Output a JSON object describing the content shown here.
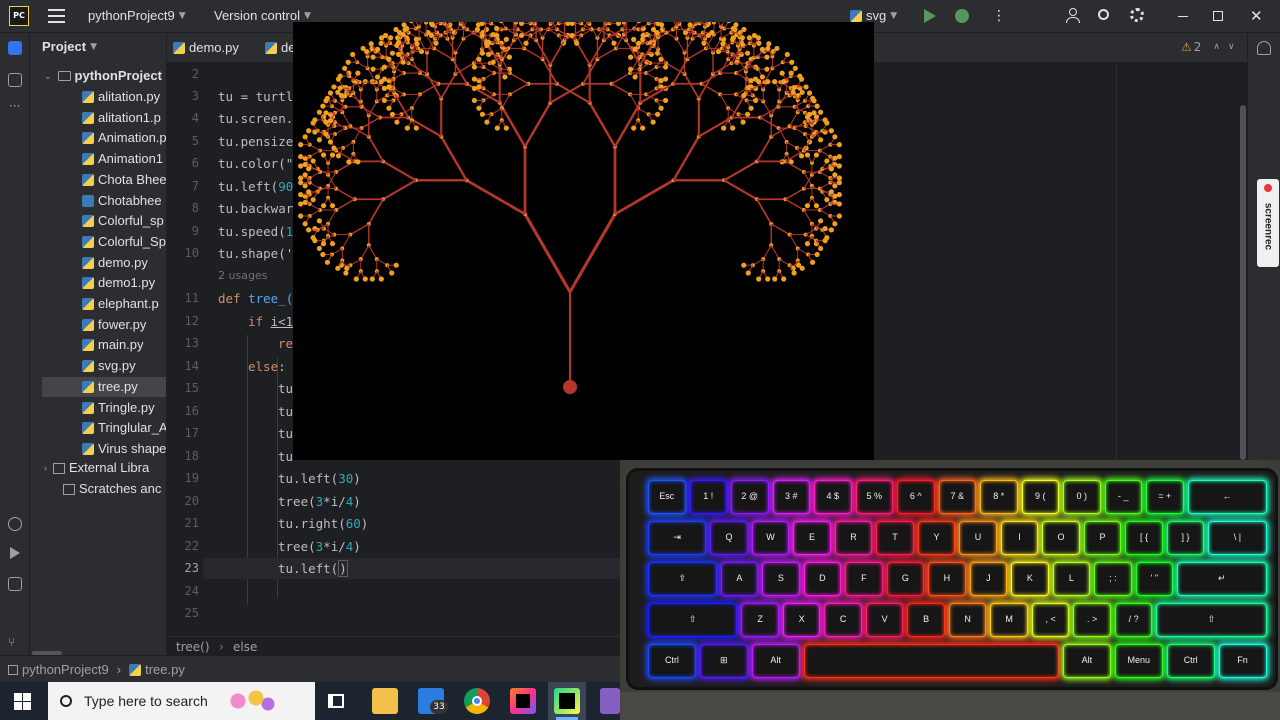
{
  "topbar": {
    "logo": "PC",
    "project_name": "pythonProject9",
    "vcs_label": "Version control",
    "run_config": "svg"
  },
  "project_panel": {
    "title": "Project",
    "root": "pythonProject",
    "files": [
      "alitation.py",
      "alitation1.p",
      "Animation.p",
      "Animation1",
      "Chota Bhee",
      "Chotabhee",
      "Colorful_sp",
      "Colorful_Sp",
      "demo.py",
      "demo1.py",
      "elephant.p",
      "fower.py",
      "main.py",
      "svg.py",
      "tree.py",
      "Tringle.py",
      "Tringlular_A",
      "Virus shape"
    ],
    "external": "External Libra",
    "scratches": "Scratches anc"
  },
  "tabs": [
    "demo.py",
    "de"
  ],
  "inspection": {
    "warnings": "2"
  },
  "editor": {
    "line_numbers": [
      "2",
      "3",
      "4",
      "5",
      "6",
      "7",
      "8",
      "9",
      "10",
      "11",
      "12",
      "13",
      "14",
      "15",
      "16",
      "17",
      "18",
      "19",
      "20",
      "21",
      "22",
      "23",
      "24",
      "25"
    ],
    "usages_hint": "2 usages",
    "lines": {
      "l3": "tu = turtl",
      "l4": "tu.screen.",
      "l5": "tu.pensize",
      "l6": "tu.color(\"",
      "l7_a": "tu.left(",
      "l7_b": "90",
      "l8": "tu.backwar",
      "l9_a": "tu.speed(",
      "l9_b": "1",
      "l10": "tu.shape('",
      "l11_kw": "def ",
      "l11_fn": "tree_(",
      "l12_kw": "if ",
      "l12_rest": "i<1",
      "l13": "re",
      "l14_kw": "else",
      "l14_rest": ":",
      "l15": "tu",
      "l16": "tu",
      "l17": "tu",
      "l18": "tu",
      "l19_a": "tu.left(",
      "l19_b": "30",
      "l19_c": ")",
      "l20_a": "tree(",
      "l20_b": "3",
      "l20_c": "*i/",
      "l20_d": "4",
      "l20_e": ")",
      "l21_a": "tu.right(",
      "l21_b": "60",
      "l21_c": ")",
      "l22_a": "tree(",
      "l22_b": "3",
      "l22_c": "*i/",
      "l22_d": "4",
      "l22_e": ")",
      "l23_a": "tu.left(",
      "l23_b": ")"
    }
  },
  "breadcrumb": {
    "first": "tree()",
    "second": "else"
  },
  "statusbar": {
    "project": "pythonProject9",
    "file": "tree.py"
  },
  "taskbar": {
    "search_placeholder": "Type here to search",
    "mail_badge": "33"
  },
  "overlay": {
    "screenrec_label": "screenrec"
  },
  "keyboard": {
    "row1": [
      "Esc",
      "1 !",
      "2 @",
      "3 #",
      "4 $",
      "5 %",
      "6 ^",
      "7 &",
      "8 *",
      "9 (",
      "0 )",
      "- _",
      "= +",
      "←"
    ],
    "row2": [
      "⇥",
      "Q",
      "W",
      "E",
      "R",
      "T",
      "Y",
      "U",
      "I",
      "O",
      "P",
      "[ {",
      "] }",
      "\\ |"
    ],
    "row3": [
      "⇪",
      "A",
      "S",
      "D",
      "F",
      "G",
      "H",
      "J",
      "K",
      "L",
      "; :",
      "' \"",
      "↵"
    ],
    "row4": [
      "⇧",
      "Z",
      "X",
      "C",
      "V",
      "B",
      "N",
      "M",
      ", <",
      ". >",
      "/ ?",
      "⇧"
    ],
    "row5": [
      "Ctrl",
      "⊞",
      "Alt",
      "",
      "Alt",
      "Menu",
      "Ctrl",
      "Fn"
    ]
  },
  "colors": {
    "accent": "#3574f0",
    "branch": "#b5362b",
    "leaf": "#f0a020",
    "keyword": "#cf8e6d",
    "number": "#2aacb8"
  }
}
